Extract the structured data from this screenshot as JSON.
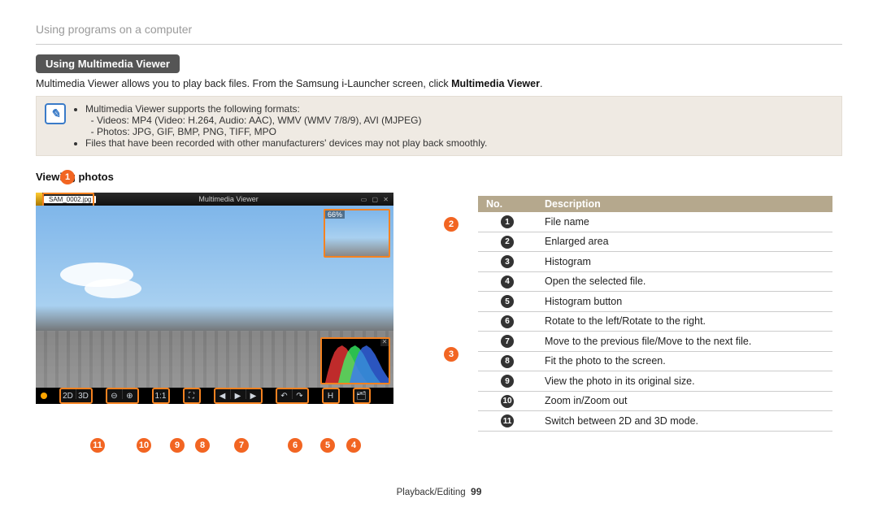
{
  "breadcrumb": "Using programs on a computer",
  "heading_pill": "Using Multimedia Viewer",
  "intro_pre": "Multimedia Viewer allows you to play back files. From the Samsung i-Launcher screen, click ",
  "intro_bold": "Multimedia Viewer",
  "intro_post": ".",
  "note": {
    "line1": "Multimedia Viewer supports the following formats:",
    "line1a": "Videos: MP4 (Video: H.264, Audio: AAC), WMV (WMV 7/8/9), AVI (MJPEG)",
    "line1b": "Photos: JPG, GIF, BMP, PNG, TIFF, MPO",
    "line2": "Files that have been recorded with other manufacturers' devices may not play back smoothly."
  },
  "subhead": "Viewing photos",
  "viewer": {
    "filename": "SAM_0002.jpg",
    "title": "Multimedia Viewer",
    "thumb_pct": "66%"
  },
  "table": {
    "col_no": "No.",
    "col_desc": "Description",
    "rows": [
      {
        "n": "1",
        "d": "File name"
      },
      {
        "n": "2",
        "d": "Enlarged area"
      },
      {
        "n": "3",
        "d": "Histogram"
      },
      {
        "n": "4",
        "d": "Open the selected file."
      },
      {
        "n": "5",
        "d": "Histogram button"
      },
      {
        "n": "6",
        "d": "Rotate to the left/Rotate to the right."
      },
      {
        "n": "7",
        "d": "Move to the previous file/Move to the next file."
      },
      {
        "n": "8",
        "d": "Fit the photo to the screen."
      },
      {
        "n": "9",
        "d": "View the photo in its original size."
      },
      {
        "n": "10",
        "d": "Zoom in/Zoom out"
      },
      {
        "n": "11",
        "d": "Switch between 2D and 3D mode."
      }
    ]
  },
  "footer_section": "Playback/Editing",
  "footer_page": "99",
  "toolbar_labels": {
    "mode2d": "2D",
    "mode3d": "3D",
    "zoom_out": "⊖",
    "zoom_in": "⊕",
    "original": "1:1",
    "fit": "⛶",
    "prev": "◀",
    "play": "▶",
    "next": "▶",
    "rot_l": "↶",
    "rot_r": "↷",
    "histo": "H",
    "open": "🗂"
  }
}
